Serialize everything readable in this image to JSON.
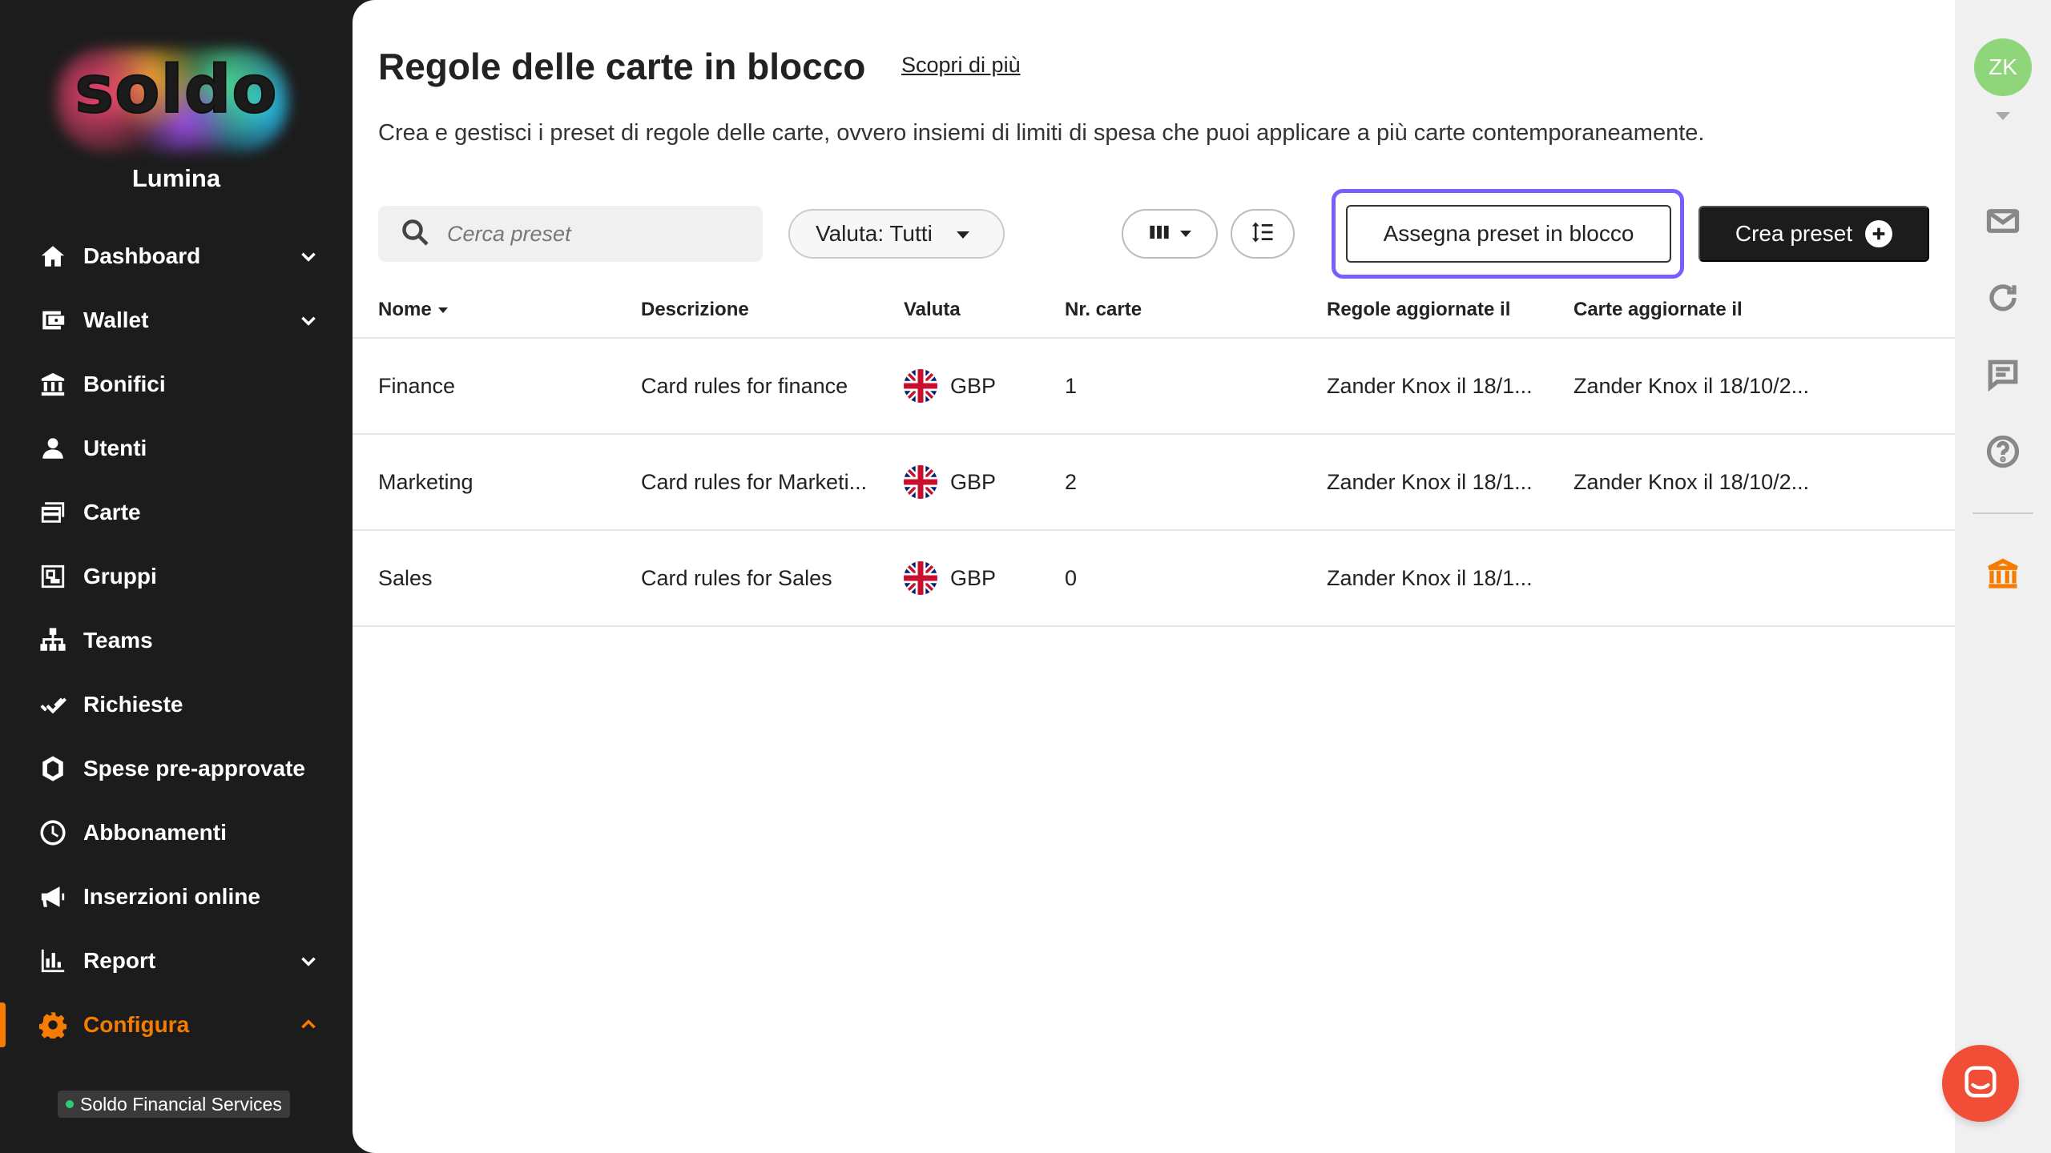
{
  "brand": {
    "logo_text": "soldo",
    "org_name": "Lumina",
    "accent": "#f57c00"
  },
  "sidebar": {
    "items": [
      {
        "label": "Dashboard",
        "icon": "home-icon",
        "has_chevron": true
      },
      {
        "label": "Wallet",
        "icon": "wallet-icon",
        "has_chevron": true
      },
      {
        "label": "Bonifici",
        "icon": "bank-transfer-icon",
        "has_chevron": false
      },
      {
        "label": "Utenti",
        "icon": "user-icon",
        "has_chevron": false
      },
      {
        "label": "Carte",
        "icon": "card-icon",
        "has_chevron": false
      },
      {
        "label": "Gruppi",
        "icon": "groups-icon",
        "has_chevron": false
      },
      {
        "label": "Teams",
        "icon": "org-chart-icon",
        "has_chevron": false
      },
      {
        "label": "Richieste",
        "icon": "double-check-icon",
        "has_chevron": false
      },
      {
        "label": "Spese pre-approvate",
        "icon": "shield-icon",
        "has_chevron": false
      },
      {
        "label": "Abbonamenti",
        "icon": "clock-icon",
        "has_chevron": false
      },
      {
        "label": "Inserzioni online",
        "icon": "megaphone-icon",
        "has_chevron": false
      },
      {
        "label": "Report",
        "icon": "bar-chart-icon",
        "has_chevron": true
      },
      {
        "label": "Configura",
        "icon": "gear-icon",
        "has_chevron": true,
        "active": true,
        "expanded": true
      }
    ],
    "company_badge": "Soldo Financial Services"
  },
  "header": {
    "title": "Regole delle carte in blocco",
    "learn_more": "Scopri di più",
    "subtitle": "Crea e gestisci i preset di regole delle carte, ovvero insiemi di limiti di spesa che puoi applicare a più carte contemporaneamente."
  },
  "toolbar": {
    "search_placeholder": "Cerca preset",
    "currency_filter": "Valuta: Tutti",
    "assign_label": "Assegna preset in blocco",
    "create_label": "Crea preset"
  },
  "table": {
    "columns": [
      "Nome",
      "Descrizione",
      "Valuta",
      "Nr. carte",
      "Regole aggiornate il",
      "Carte aggiornate il"
    ],
    "rows": [
      {
        "name": "Finance",
        "description": "Card rules for finance",
        "currency": "GBP",
        "cards": "1",
        "rules_updated": "Zander Knox il 18/1...",
        "cards_updated": "Zander Knox il 18/10/2..."
      },
      {
        "name": "Marketing",
        "description": "Card rules for Marketi...",
        "currency": "GBP",
        "cards": "2",
        "rules_updated": "Zander Knox il 18/1...",
        "cards_updated": "Zander Knox il 18/10/2..."
      },
      {
        "name": "Sales",
        "description": "Card rules for Sales",
        "currency": "GBP",
        "cards": "0",
        "rules_updated": "Zander Knox il 18/1...",
        "cards_updated": ""
      }
    ]
  },
  "rail": {
    "avatar_initials": "ZK",
    "avatar_color": "#8fd67a",
    "icons": [
      "mail-icon",
      "refresh-icon",
      "message-icon",
      "help-icon",
      "bank-icon"
    ]
  },
  "colors": {
    "focus_ring": "#7b5cff",
    "chat_fab": "#f04e37"
  }
}
